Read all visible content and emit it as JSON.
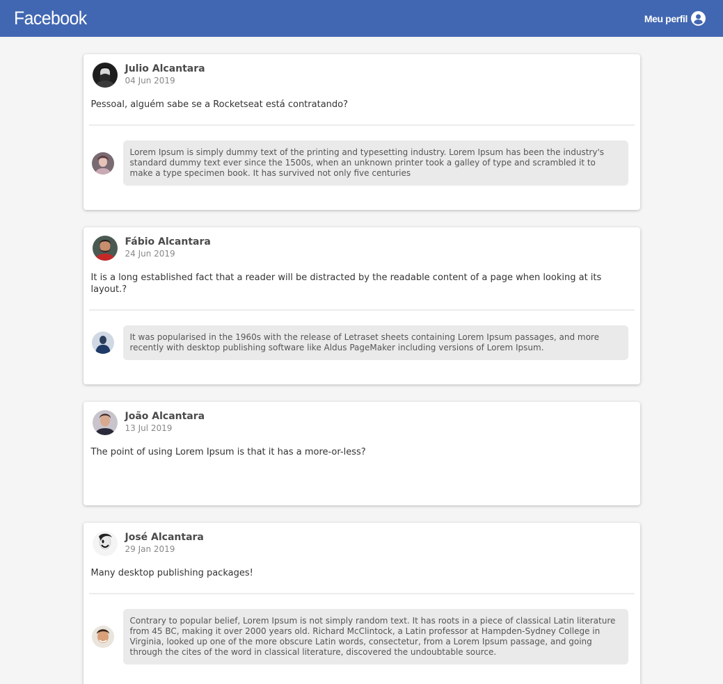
{
  "header": {
    "logo": "Facebook",
    "profile_label": "Meu perfil",
    "profile_icon": "user-circle-icon",
    "color": "#4267b2"
  },
  "posts": [
    {
      "author": "Julio Alcantara",
      "date": "04 Jun 2019",
      "content": "Pessoal, alguém sabe se a Rocketseat está contratando?",
      "comment": "Lorem Ipsum is simply dummy text of the printing and typesetting industry. Lorem Ipsum has been the industry's standard dummy text ever since the 1500s, when an unknown printer took a galley of type and scrambled it to make a type specimen book. It has survived not only five centuries"
    },
    {
      "author": "Fábio Alcantara",
      "date": "24 Jun 2019",
      "content": "It is a long established fact that a reader will be distracted by the readable content of a page when looking at its layout.?",
      "comment": "It was popularised in the 1960s with the release of Letraset sheets containing Lorem Ipsum passages, and more recently with desktop publishing software like Aldus PageMaker including versions of Lorem Ipsum."
    },
    {
      "author": "João Alcantara",
      "date": "13 Jul 2019",
      "content": "The point of using Lorem Ipsum is that it has a more-or-less?"
    },
    {
      "author": "José Alcantara",
      "date": "29 Jan 2019",
      "content": "Many desktop publishing packages!",
      "comment": "Contrary to popular belief, Lorem Ipsum is not simply random text. It has roots in a piece of classical Latin literature from 45 BC, making it over 2000 years old. Richard McClintock, a Latin professor at Hampden-Sydney College in Virginia, looked up one of the more obscure Latin words, consectetur, from a Lorem Ipsum passage, and going through the cites of the word in classical literature, discovered the undoubtable source."
    }
  ]
}
